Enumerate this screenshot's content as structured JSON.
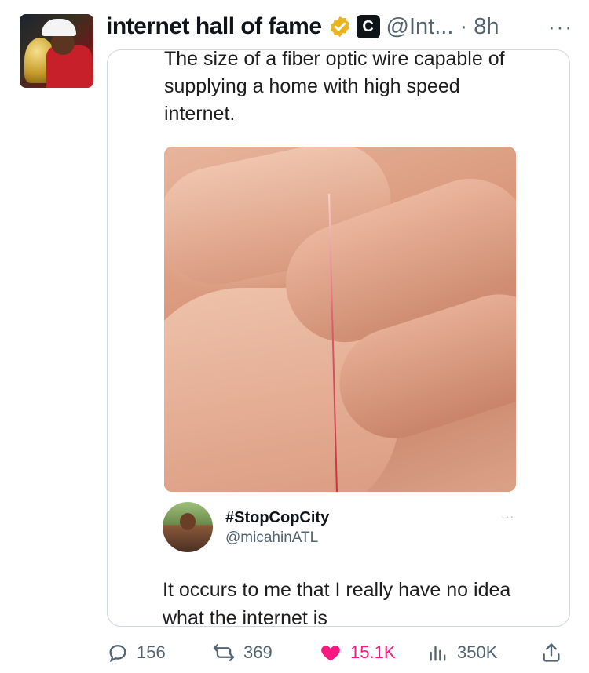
{
  "tweet": {
    "display_name": "internet hall of fame",
    "handle": "@Int...",
    "separator": "·",
    "time": "8h",
    "more": "···",
    "verified_icon": "verified-gold-badge-icon",
    "org_badge_letter": "C"
  },
  "quoted_text": "The size of a fiber optic wire capable of supplying a home with high speed internet.",
  "inner_tweet": {
    "name": "#StopCopCity",
    "handle": "@micahinATL",
    "more": "···",
    "body": "It occurs to me that I really have no idea what the internet is"
  },
  "actions": {
    "replies": "156",
    "retweets": "369",
    "likes": "15.1K",
    "views": "350K"
  },
  "colors": {
    "like": "#f91880",
    "muted": "#536471",
    "verified": "#e8b422"
  }
}
